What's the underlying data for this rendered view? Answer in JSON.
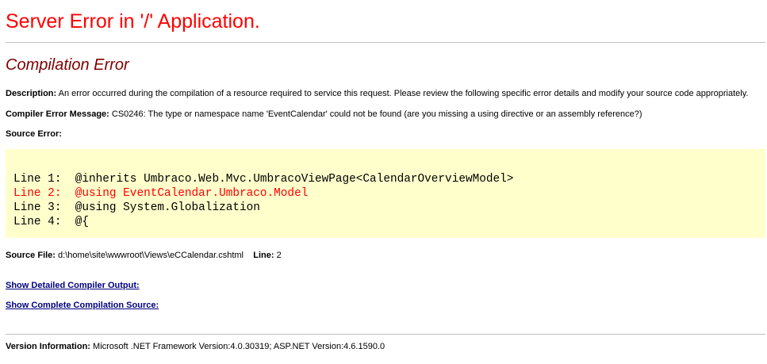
{
  "page": {
    "title": "Server Error in '/' Application.",
    "subtitle": "Compilation Error"
  },
  "description": {
    "label": "Description:",
    "text": "An error occurred during the compilation of a resource required to service this request. Please review the following specific error details and modify your source code appropriately."
  },
  "compiler_error": {
    "label": "Compiler Error Message:",
    "text": "CS0246: The type or namespace name 'EventCalendar' could not be found (are you missing a using directive or an assembly reference?)"
  },
  "source_error": {
    "label": "Source Error:",
    "lines": [
      {
        "text": "Line 1:  @inherits Umbraco.Web.Mvc.UmbracoViewPage<CalendarOverviewModel>",
        "is_error": false
      },
      {
        "text": "Line 2:  @using EventCalendar.Umbraco.Model",
        "is_error": true
      },
      {
        "text": "Line 3:  @using System.Globalization",
        "is_error": false
      },
      {
        "text": "Line 4:  @{",
        "is_error": false
      }
    ]
  },
  "source_file": {
    "label": "Source File:",
    "path": "d:\\home\\site\\wwwroot\\Views\\eCCalendar.cshtml",
    "line_label": "Line:",
    "line_value": "2"
  },
  "links": {
    "detailed_output": "Show Detailed Compiler Output:",
    "complete_source": "Show Complete Compilation Source:"
  },
  "version": {
    "label": "Version Information:",
    "text": "Microsoft .NET Framework Version:4.0.30319; ASP.NET Version:4.6.1590.0"
  },
  "colors": {
    "title": "#ff0000",
    "subtitle": "#800000",
    "code_background": "#ffffcc",
    "error_line": "#ff0000",
    "link": "#000080",
    "rule": "#c0c0c0"
  }
}
